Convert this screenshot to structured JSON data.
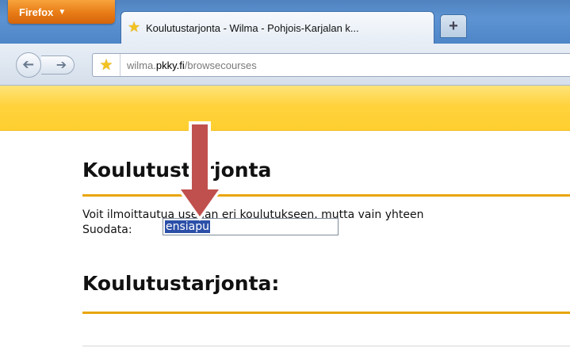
{
  "browser": {
    "menu_button": "Firefox",
    "tab_title": "Koulutustarjonta - Wilma - Pohjois-Karjalan k...",
    "tab_favicon": "star-icon",
    "new_tab_label": "+",
    "url_prefix": "wilma.",
    "url_domain": "pkky.fi",
    "url_path": "/browsecourses"
  },
  "page": {
    "heading": "Koulutustarjonta",
    "intro": "Voit ilmoittautua useaan eri koulutukseen, mutta vain yhteen",
    "filter_label": "Suodata:",
    "filter_value": "ensiapu",
    "list_heading": "Koulutustarjonta:"
  },
  "colors": {
    "accent_rule": "#e9a50c",
    "banner": "#ffd23d",
    "arrow": "#c0504d",
    "selection": "#2b4fa8"
  }
}
